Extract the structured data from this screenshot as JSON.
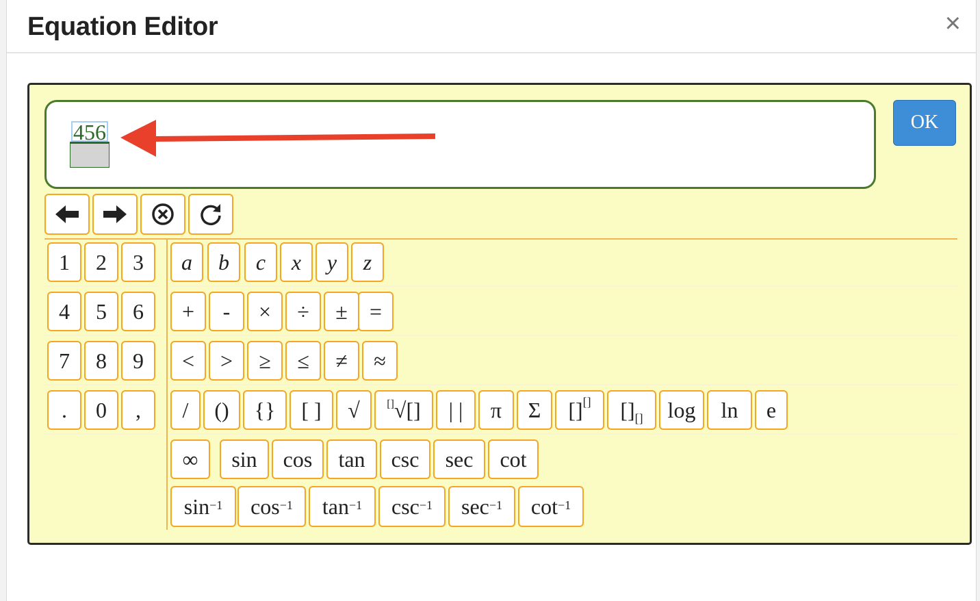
{
  "dialog": {
    "title": "Equation Editor",
    "close_icon": "×"
  },
  "equation": {
    "numerator": "456"
  },
  "ok_label": "OK",
  "controls": [
    {
      "name": "move-left-arrow-icon",
      "glyph": "🡐"
    },
    {
      "name": "move-right-arrow-icon",
      "glyph": "🡒"
    },
    {
      "name": "clear-circle-x-icon",
      "glyph": "⊗"
    },
    {
      "name": "refresh-icon",
      "glyph": "↻"
    }
  ],
  "digits": [
    [
      "1",
      "2",
      "3"
    ],
    [
      "4",
      "5",
      "6"
    ],
    [
      "7",
      "8",
      "9"
    ],
    [
      ".",
      "0",
      ","
    ]
  ],
  "variables": [
    "a",
    "b",
    "c",
    "x",
    "y",
    "z"
  ],
  "operators": [
    "+",
    "-",
    "×",
    "÷",
    "±",
    "="
  ],
  "relations": [
    "<",
    ">",
    "≥",
    "≤",
    "≠",
    "≈"
  ],
  "functions": [
    "/",
    "()",
    "{}",
    "[ ]",
    "√",
    "[]√[]",
    "| |",
    "π",
    "Σ",
    "[][]",
    "[][]",
    "log",
    "ln",
    "e"
  ],
  "trig": [
    "∞",
    "sin",
    "cos",
    "tan",
    "csc",
    "sec",
    "cot"
  ],
  "inverse_trig": [
    "sin",
    "cos",
    "tan",
    "csc",
    "sec",
    "cot"
  ],
  "inverse_exponent": "−1",
  "colors": {
    "accent": "#3d8ed6",
    "key_border": "#f5a623",
    "panel_bg": "#fafcc4",
    "input_border": "#4a7a2c",
    "arrow": "#e8402a"
  }
}
